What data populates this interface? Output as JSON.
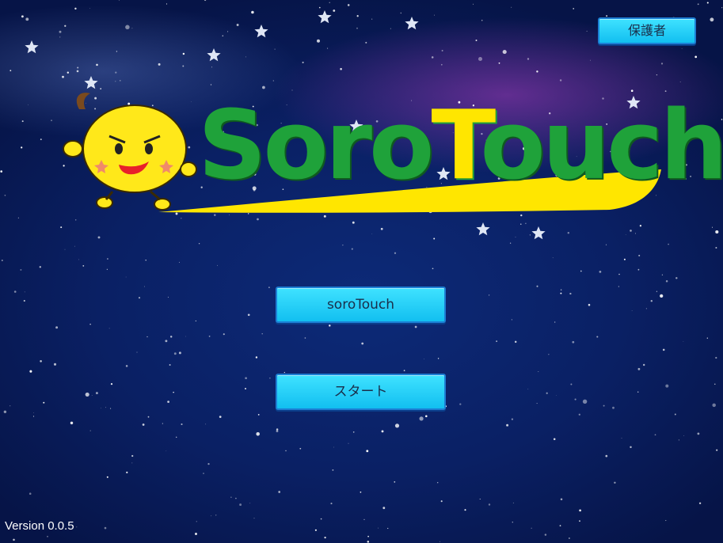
{
  "header": {
    "guardian_button_label": "保護者"
  },
  "logo": {
    "text_prefix": "Soro",
    "text_mid": "T",
    "text_suffix": "ouch",
    "text_color": "#1fa23a",
    "accent_color": "#ffe600"
  },
  "menu": {
    "sorotouch_button_label": "soroTouch",
    "start_button_label": "スタート"
  },
  "footer": {
    "version_text": "Version 0.0.5"
  },
  "colors": {
    "button_fill": "#12bff0",
    "background": "#0a2064"
  }
}
